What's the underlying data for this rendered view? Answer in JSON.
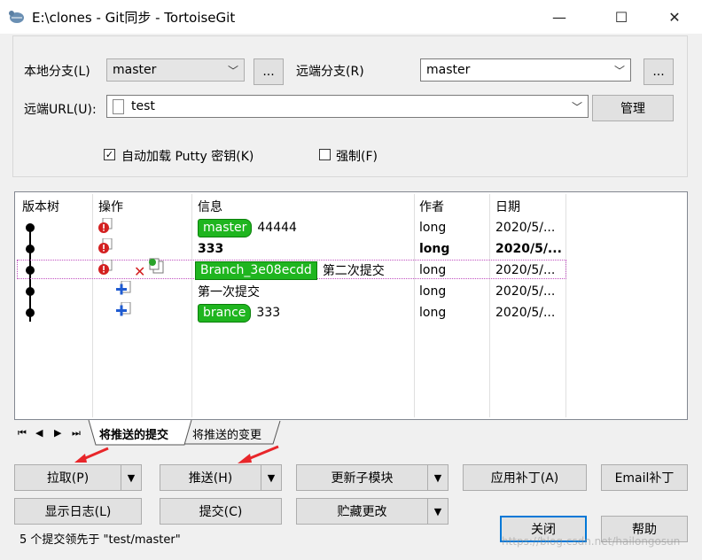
{
  "window": {
    "title": "E:\\clones - Git同步 - TortoiseGit",
    "minimize_glyph": "—",
    "maximize_glyph": "☐",
    "close_glyph": "✕"
  },
  "form": {
    "local_branch_label": "本地分支(L)",
    "local_branch_value": "master",
    "browse_label": "...",
    "remote_branch_label": "远端分支(R)",
    "remote_branch_value": "master",
    "remote_url_label": "远端URL(U):",
    "remote_url_value": "test",
    "manage_label": "管理",
    "autoload_putty_label": "自动加载 Putty 密钥(K)",
    "autoload_putty_checked": true,
    "force_label": "强制(F)",
    "force_checked": false
  },
  "log": {
    "columns": [
      "版本树",
      "操作",
      "信息",
      "作者",
      "日期"
    ],
    "rows": [
      {
        "tag": "master",
        "message": "44444",
        "author": "long",
        "date": "2020/5/...",
        "bold": false,
        "ops": [
          "error-icon"
        ]
      },
      {
        "tag": "",
        "message": "333",
        "author": "long",
        "date": "2020/5/...",
        "bold": true,
        "ops": [
          "error-icon"
        ]
      },
      {
        "tag": "Branch_3e08ecdd",
        "message": "第二次提交",
        "author": "long",
        "date": "2020/5/...",
        "bold": false,
        "ops": [
          "error-icon",
          "delete-icon",
          "copy-icon"
        ]
      },
      {
        "tag": "",
        "message": "第一次提交",
        "author": "long",
        "date": "2020/5/...",
        "bold": false,
        "ops": [
          "add-icon"
        ]
      },
      {
        "tag": "brance",
        "message": "333",
        "author": "long",
        "date": "2020/5/...",
        "bold": false,
        "ops": [
          "add-icon"
        ]
      }
    ]
  },
  "tabs": {
    "first_glyph": "⏮",
    "prev_glyph": "◀",
    "next_glyph": "▶",
    "last_glyph": "⏭",
    "items": [
      "将推送的提交",
      "将推送的变更"
    ]
  },
  "buttons": {
    "pull": "拉取(P)",
    "push": "推送(H)",
    "update_submodules": "更新子模块",
    "apply_patch": "应用补丁(A)",
    "email_patch": "Email补丁",
    "show_log": "显示日志(L)",
    "commit": "提交(C)",
    "stash": "贮藏更改",
    "close": "关闭",
    "help": "帮助",
    "dropdown_glyph": "▼"
  },
  "status": {
    "text": "5 个提交领先于 \"test/master\""
  },
  "watermark": "https://blog.csdn.net/hailongosun",
  "colors": {
    "tag_green": "#1fb51f",
    "error_red": "#d32020",
    "add_blue": "#1f5bd1",
    "primary_border": "#0078d7",
    "annotation_red": "#e8262a"
  }
}
